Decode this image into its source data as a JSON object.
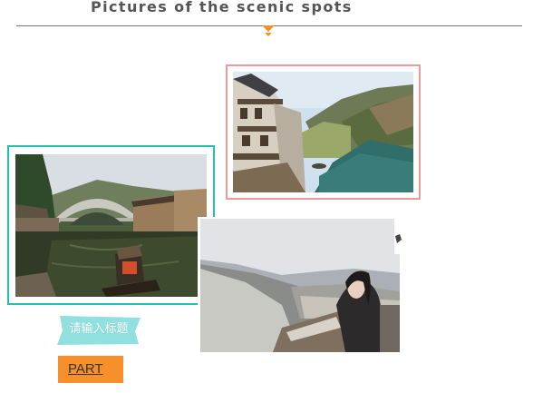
{
  "header": {
    "title": "Pictures of the scenic spots"
  },
  "photos": {
    "canal_village": {
      "subject": "stone-houses-along-canal"
    },
    "arched_bridge": {
      "subject": "arched-bridge-with-boat"
    },
    "snowy_wall": {
      "subject": "woman-on-snowy-great-wall"
    }
  },
  "tag": {
    "label": "请输入标题"
  },
  "part_button": {
    "label": "PART"
  },
  "colors": {
    "accent_orange": "#f7902a",
    "teal_frame": "#22c1b3",
    "pink_frame": "#ef9a9a",
    "tag_background": "#8fe0de",
    "heading_text": "#555555"
  }
}
